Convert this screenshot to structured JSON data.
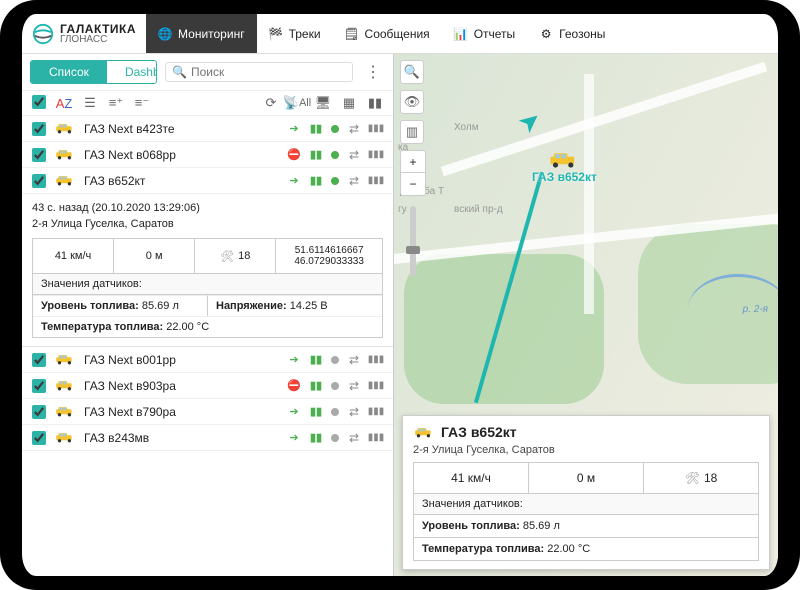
{
  "brand": {
    "line1": "ГАЛАКТИКА",
    "line2": "ГЛОНАСС"
  },
  "nav": {
    "monitoring": "Мониторинг",
    "tracks": "Треки",
    "messages": "Сообщения",
    "reports": "Отчеты",
    "geozones": "Геозоны"
  },
  "tabs": {
    "list": "Список",
    "dashboard": "Dashboard"
  },
  "search": {
    "placeholder": "Поиск"
  },
  "toolbar": {
    "all": "All"
  },
  "units": [
    {
      "name": "ГАЗ Next в423те",
      "motion": "green",
      "online": true
    },
    {
      "name": "ГАЗ Next в068рр",
      "motion": "red",
      "online": true
    },
    {
      "name": "ГАЗ в652кт",
      "motion": "green",
      "online": true
    }
  ],
  "detail": {
    "ago": "43 с. назад (20.10.2020 13:29:06)",
    "address": "2-я Улица Гуселка, Саратов",
    "speed": "41 км/ч",
    "distance": "0 м",
    "sat": "18",
    "coords": "51.6114616667\n46.0729033333",
    "sensors_header": "Значения датчиков:",
    "fuel_label": "Уровень топлива:",
    "fuel_value": "85.69 л",
    "voltage_label": "Напряжение:",
    "voltage_value": "14.25 В",
    "ftemp_label": "Температура топлива:",
    "ftemp_value": "22.00 °С"
  },
  "units2": [
    {
      "name": "ГАЗ Next в001рр",
      "motion": "green",
      "online": false
    },
    {
      "name": "ГАЗ Next в903ра",
      "motion": "red",
      "online": false
    },
    {
      "name": "ГАЗ Next в790ра",
      "motion": "green",
      "online": false
    },
    {
      "name": "ГАЗ в243мв",
      "motion": "green",
      "online": false
    }
  ],
  "map": {
    "labels": {
      "kholm": "Холм",
      "druzhba": "Дружба Т",
      "vsky": "вский пр-д",
      "gu": "гу",
      "ka": "ка",
      "river": "р. 2-я"
    },
    "marker_label": "ГАЗ в652кт"
  },
  "popup": {
    "title": "ГАЗ в652кт",
    "address": "2-я Улица Гуселка, Саратов",
    "speed": "41 км/ч",
    "distance": "0 м",
    "sat": "18",
    "sensors_header": "Значения датчиков:",
    "fuel_label": "Уровень топлива:",
    "fuel_value": "85.69 л",
    "ftemp_label": "Температура топлива:",
    "ftemp_value": "22.00 °С"
  }
}
